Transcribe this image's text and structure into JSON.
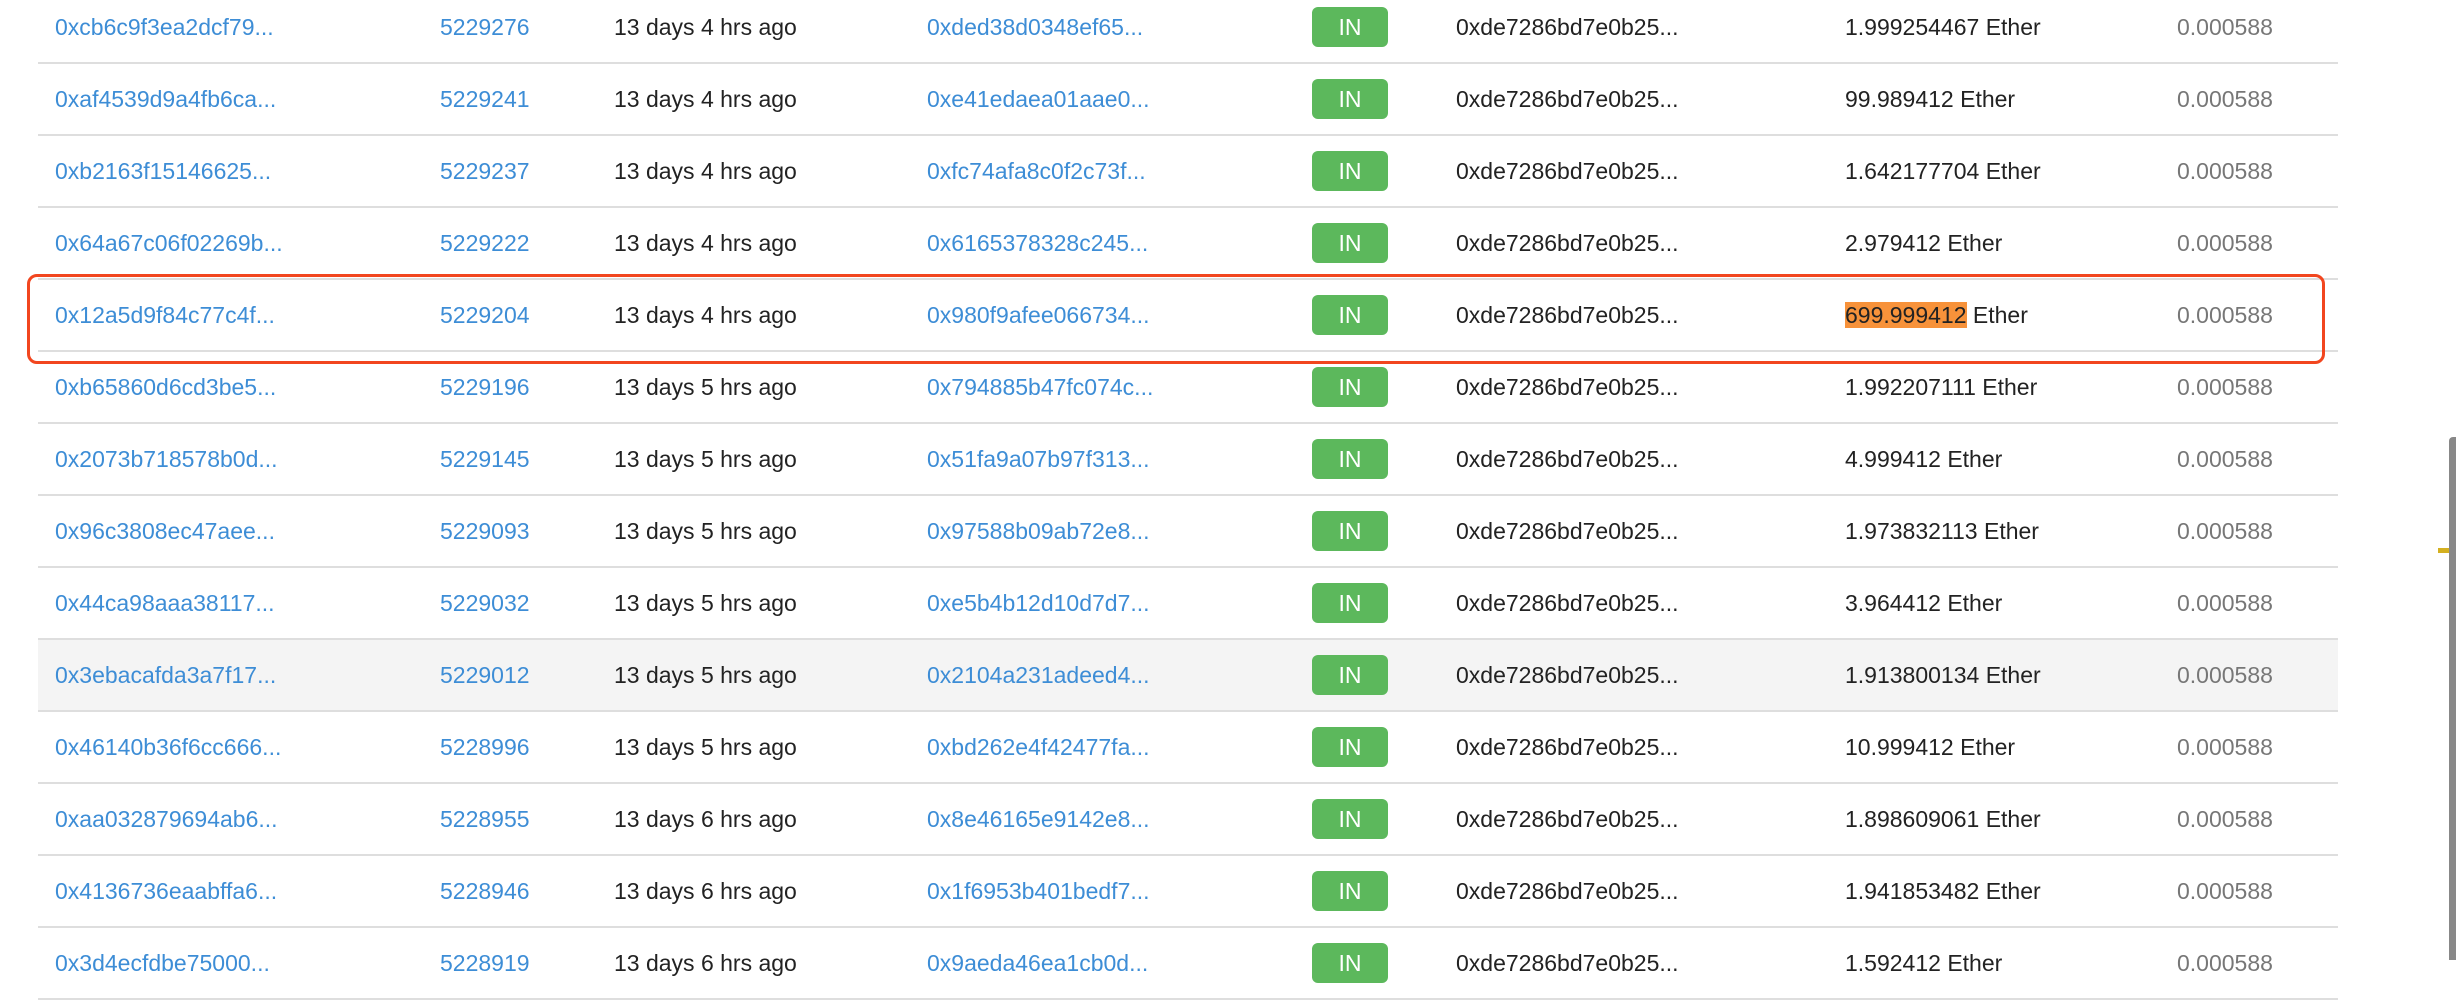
{
  "colors": {
    "link": "#3d8dd6",
    "badge": "#5cb85c",
    "highlight_box": "#f2461f",
    "text_highlight": "#f7923a"
  },
  "rows": [
    {
      "txhash": "0xcb6c9f3ea2dcf79...",
      "block": "5229276",
      "age": "13 days 4 hrs ago",
      "from": "0xded38d0348ef65...",
      "direction": "IN",
      "to": "0xde7286bd7e0b25...",
      "value": "1.999254467 Ether",
      "fee": "0.000588"
    },
    {
      "txhash": "0xaf4539d9a4fb6ca...",
      "block": "5229241",
      "age": "13 days 4 hrs ago",
      "from": "0xe41edaea01aae0...",
      "direction": "IN",
      "to": "0xde7286bd7e0b25...",
      "value": "99.989412 Ether",
      "fee": "0.000588"
    },
    {
      "txhash": "0xb2163f15146625...",
      "block": "5229237",
      "age": "13 days 4 hrs ago",
      "from": "0xfc74afa8c0f2c73f...",
      "direction": "IN",
      "to": "0xde7286bd7e0b25...",
      "value": "1.642177704 Ether",
      "fee": "0.000588"
    },
    {
      "txhash": "0x64a67c06f02269b...",
      "block": "5229222",
      "age": "13 days 4 hrs ago",
      "from": "0x6165378328c245...",
      "direction": "IN",
      "to": "0xde7286bd7e0b25...",
      "value": "2.979412 Ether",
      "fee": "0.000588"
    },
    {
      "txhash": "0x12a5d9f84c77c4f...",
      "block": "5229204",
      "age": "13 days 4 hrs ago",
      "from": "0x980f9afee066734...",
      "direction": "IN",
      "to": "0xde7286bd7e0b25...",
      "value_highlighted": "699.999412",
      "value_unit": " Ether",
      "fee": "0.000588"
    },
    {
      "txhash": "0xb65860d6cd3be5...",
      "block": "5229196",
      "age": "13 days 5 hrs ago",
      "from": "0x794885b47fc074c...",
      "direction": "IN",
      "to": "0xde7286bd7e0b25...",
      "value": "1.992207111 Ether",
      "fee": "0.000588"
    },
    {
      "txhash": "0x2073b718578b0d...",
      "block": "5229145",
      "age": "13 days 5 hrs ago",
      "from": "0x51fa9a07b97f313...",
      "direction": "IN",
      "to": "0xde7286bd7e0b25...",
      "value": "4.999412 Ether",
      "fee": "0.000588"
    },
    {
      "txhash": "0x96c3808ec47aee...",
      "block": "5229093",
      "age": "13 days 5 hrs ago",
      "from": "0x97588b09ab72e8...",
      "direction": "IN",
      "to": "0xde7286bd7e0b25...",
      "value": "1.973832113 Ether",
      "fee": "0.000588"
    },
    {
      "txhash": "0x44ca98aaa38117...",
      "block": "5229032",
      "age": "13 days 5 hrs ago",
      "from": "0xe5b4b12d10d7d7...",
      "direction": "IN",
      "to": "0xde7286bd7e0b25...",
      "value": "3.964412 Ether",
      "fee": "0.000588"
    },
    {
      "txhash": "0x3ebacafda3a7f17...",
      "block": "5229012",
      "age": "13 days 5 hrs ago",
      "from": "0x2104a231adeed4...",
      "direction": "IN",
      "to": "0xde7286bd7e0b25...",
      "value": "1.913800134 Ether",
      "fee": "0.000588"
    },
    {
      "txhash": "0x46140b36f6cc666...",
      "block": "5228996",
      "age": "13 days 5 hrs ago",
      "from": "0xbd262e4f42477fa...",
      "direction": "IN",
      "to": "0xde7286bd7e0b25...",
      "value": "10.999412 Ether",
      "fee": "0.000588"
    },
    {
      "txhash": "0xaa032879694ab6...",
      "block": "5228955",
      "age": "13 days 6 hrs ago",
      "from": "0x8e46165e9142e8...",
      "direction": "IN",
      "to": "0xde7286bd7e0b25...",
      "value": "1.898609061 Ether",
      "fee": "0.000588"
    },
    {
      "txhash": "0x4136736eaabffa6...",
      "block": "5228946",
      "age": "13 days 6 hrs ago",
      "from": "0x1f6953b401bedf7...",
      "direction": "IN",
      "to": "0xde7286bd7e0b25...",
      "value": "1.941853482 Ether",
      "fee": "0.000588"
    },
    {
      "txhash": "0x3d4ecfdbe75000...",
      "block": "5228919",
      "age": "13 days 6 hrs ago",
      "from": "0x9aeda46ea1cb0d...",
      "direction": "IN",
      "to": "0xde7286bd7e0b25...",
      "value": "1.592412 Ether",
      "fee": "0.000588"
    }
  ]
}
